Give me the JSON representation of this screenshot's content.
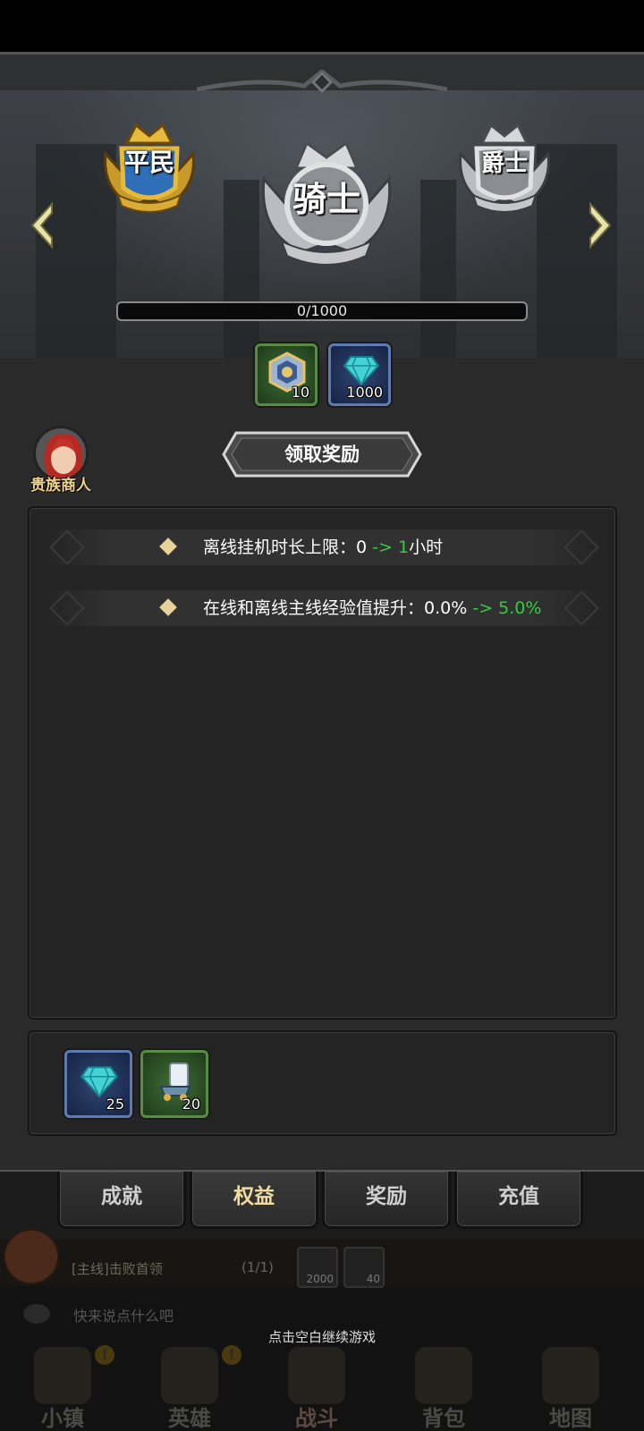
{
  "ranks": {
    "previous": "平民",
    "current": "骑士",
    "next": "爵士"
  },
  "progress": {
    "text": "0/1000",
    "fraction": 0
  },
  "rank_rewards": [
    {
      "icon": "hexagon-chest-icon",
      "qty": "10"
    },
    {
      "icon": "diamond-icon",
      "qty": "1000"
    }
  ],
  "merchant": {
    "label": "贵族商人"
  },
  "claim_button": {
    "label": "领取奖励"
  },
  "benefits": [
    {
      "label": "离线挂机时长上限：",
      "from": "0",
      "arrow": " -> ",
      "to": "1",
      "suffix": "小时"
    },
    {
      "label": "在线和离线主线经验值提升：",
      "from": "0.0%",
      "arrow": " -> ",
      "to": "5.0%",
      "suffix": ""
    }
  ],
  "daily_rewards": [
    {
      "icon": "diamond-icon",
      "qty": "25"
    },
    {
      "icon": "scroll-cart-icon",
      "qty": "20"
    }
  ],
  "tabs": [
    {
      "label": "成就",
      "active": false
    },
    {
      "label": "权益",
      "active": true
    },
    {
      "label": "奖励",
      "active": false
    },
    {
      "label": "充值",
      "active": false
    }
  ],
  "quest": {
    "text": "[主线]击败首领",
    "count": "(1/1)",
    "items": [
      {
        "qty": "2000"
      },
      {
        "qty": "40"
      }
    ]
  },
  "chat": {
    "placeholder": "快来说点什么吧"
  },
  "hint": "点击空白继续游戏",
  "nav": [
    {
      "label": "小镇",
      "alert": "!"
    },
    {
      "label": "英雄",
      "alert": "!"
    },
    {
      "label": "战斗",
      "alert": ""
    },
    {
      "label": "背包",
      "alert": ""
    },
    {
      "label": "地图",
      "alert": ""
    }
  ],
  "colors": {
    "green_highlight": "#2fd13b",
    "gold_text": "#f2d488",
    "tab_active": "#f3dca0"
  }
}
